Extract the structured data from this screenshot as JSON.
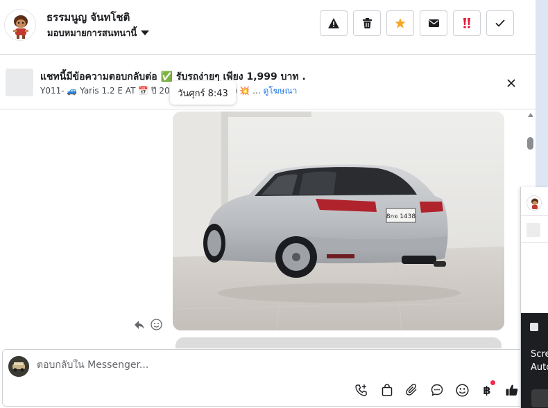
{
  "header": {
    "contact_name": "ธรรมนูญ จันทโชติ",
    "assign_label": "มอบหมายการสนทนานี้",
    "actions": [
      {
        "name": "spam-button",
        "icon": "warning-icon"
      },
      {
        "name": "delete-button",
        "icon": "trash-icon"
      },
      {
        "name": "star-button",
        "icon": "star-icon"
      },
      {
        "name": "mark-unread-button",
        "icon": "envelope-icon"
      },
      {
        "name": "follow-up-button",
        "icon": "urgent-icon"
      },
      {
        "name": "mark-done-button",
        "icon": "check-icon"
      }
    ]
  },
  "context_bar": {
    "title": "แชทนี้มีข้อความตอบกลับต่อ ✅ รับรถง่ายๆ เพียง 1,999 บาท .",
    "subtitle_prefix": "Y011- 🚙 Yaris 1.2 E AT 📅 ปี 2017",
    "subtitle_suffix": "ชิ้น | 🚗 เก่ง 💥 ...",
    "link_label": "ดูโฆษณา",
    "tooltip": "วันศุกร์ 8:43"
  },
  "message": {
    "plate_text": "8กจ 1438"
  },
  "composer": {
    "placeholder": "ตอบกลับใน Messenger...",
    "baht_symbol": "฿"
  },
  "side_panel": {
    "line1": "Scre",
    "line2": "Auto"
  },
  "colors": {
    "accent": "#1b74e4",
    "star": "#f5a623",
    "urgent": "#e41e3f",
    "thumbs": "#1c1e21"
  }
}
